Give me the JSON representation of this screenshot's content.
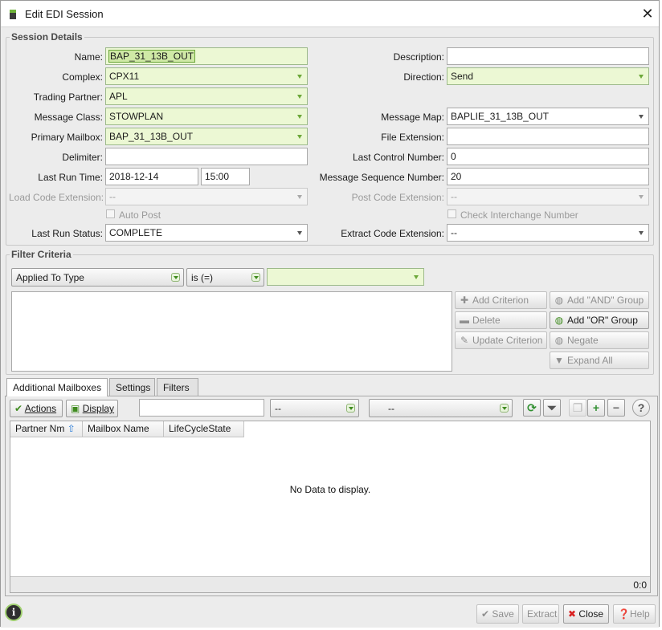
{
  "window": {
    "title": "Edit EDI Session"
  },
  "session": {
    "legend": "Session Details",
    "name": {
      "label": "Name:",
      "value": "BAP_31_13B_OUT"
    },
    "description": {
      "label": "Description:",
      "value": ""
    },
    "complex": {
      "label": "Complex:",
      "value": "CPX11"
    },
    "direction": {
      "label": "Direction:",
      "value": "Send"
    },
    "trading_partner": {
      "label": "Trading Partner:",
      "value": "APL"
    },
    "message_class": {
      "label": "Message Class:",
      "value": "STOWPLAN"
    },
    "message_map": {
      "label": "Message Map:",
      "value": "BAPLIE_31_13B_OUT"
    },
    "primary_mailbox": {
      "label": "Primary Mailbox:",
      "value": "BAP_31_13B_OUT"
    },
    "file_extension": {
      "label": "File Extension:",
      "value": ""
    },
    "delimiter": {
      "label": "Delimiter:",
      "value": ""
    },
    "last_control_number": {
      "label": "Last Control Number:",
      "value": "0"
    },
    "last_run_time": {
      "label": "Last Run Time:",
      "date": "2018-12-14",
      "time": "15:00"
    },
    "message_sequence_number": {
      "label": "Message Sequence Number:",
      "value": "20"
    },
    "load_code_extension": {
      "label": "Load Code Extension:",
      "value": "--"
    },
    "post_code_extension": {
      "label": "Post Code Extension:",
      "value": "--"
    },
    "auto_post": {
      "label": "Auto Post",
      "checked": false
    },
    "check_interchange": {
      "label": "Check Interchange Number",
      "checked": false
    },
    "last_run_status": {
      "label": "Last Run Status:",
      "value": "COMPLETE"
    },
    "extract_code_extension": {
      "label": "Extract Code Extension:",
      "value": "--"
    }
  },
  "filter": {
    "legend": "Filter Criteria",
    "field": "Applied To Type",
    "operator": "is (=)",
    "value": "",
    "buttons": {
      "add_criterion": "Add Criterion",
      "add_and_group": "Add \"AND\" Group",
      "delete": "Delete",
      "add_or_group": "Add \"OR\" Group",
      "update_criterion": "Update Criterion",
      "negate": "Negate",
      "expand_all": "Expand All"
    }
  },
  "tabs": [
    "Additional Mailboxes",
    "Settings",
    "Filters"
  ],
  "toolbar": {
    "actions": "Actions",
    "display": "Display",
    "search_value": "",
    "filter1": "--",
    "filter2": "--"
  },
  "grid": {
    "columns": [
      "Partner Nm",
      "Mailbox Name",
      "LifeCycleState"
    ],
    "empty_message": "No Data to display.",
    "count": "0:0"
  },
  "footer": {
    "save": "Save",
    "extract": "Extract",
    "close": "Close",
    "help": "Help"
  },
  "colors": {
    "required_bg": "#ecf8d4",
    "accent_green": "#3f8b1f",
    "close_red": "#d92020"
  }
}
